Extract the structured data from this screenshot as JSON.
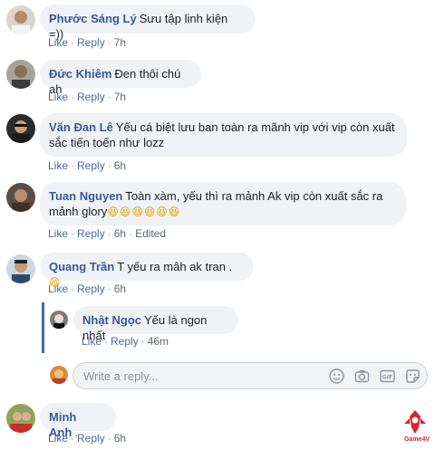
{
  "actions": {
    "like": "Like",
    "reply": "Reply",
    "edited": "Edited"
  },
  "comments": [
    {
      "author": "Phước Sáng Lý",
      "text": "Sưu tập linh kiện =))",
      "time": "7h"
    },
    {
      "author": "Đức Khiêm",
      "text": "Đen thôi chú ah",
      "time": "7h"
    },
    {
      "author": "Văn Đan Lê",
      "text_line1": "Yếu cá biệt lưu ban toàn ra mãnh vip với vip còn xuất",
      "text_line2": "sắc tiến toến như lozz",
      "time": "6h"
    },
    {
      "author": "Tuan Nguyen",
      "text_line1": "Toàn xàm, yếu thì ra mảnh Ak vip còn xuất sắc ra",
      "text_line2": "mảnh glory",
      "emoji": "😆😆😆😆😆😆",
      "time": "6h"
    },
    {
      "author": "Quang Trần",
      "text": "T yếu ra mâh ak tran .",
      "emoji": "😆",
      "time": "6h"
    },
    {
      "author": "Minh Anh",
      "text": ".",
      "time": "6h"
    }
  ],
  "reply": {
    "author": "Nhật Ngọc",
    "text": "Yếu là ngon nhất",
    "time": "46m"
  },
  "reply_input": {
    "placeholder": "Write a reply..."
  },
  "watermark": {
    "text": "Game4V"
  },
  "icons": [
    "smiley-icon",
    "camera-icon",
    "gif-icon",
    "sticker-icon"
  ]
}
